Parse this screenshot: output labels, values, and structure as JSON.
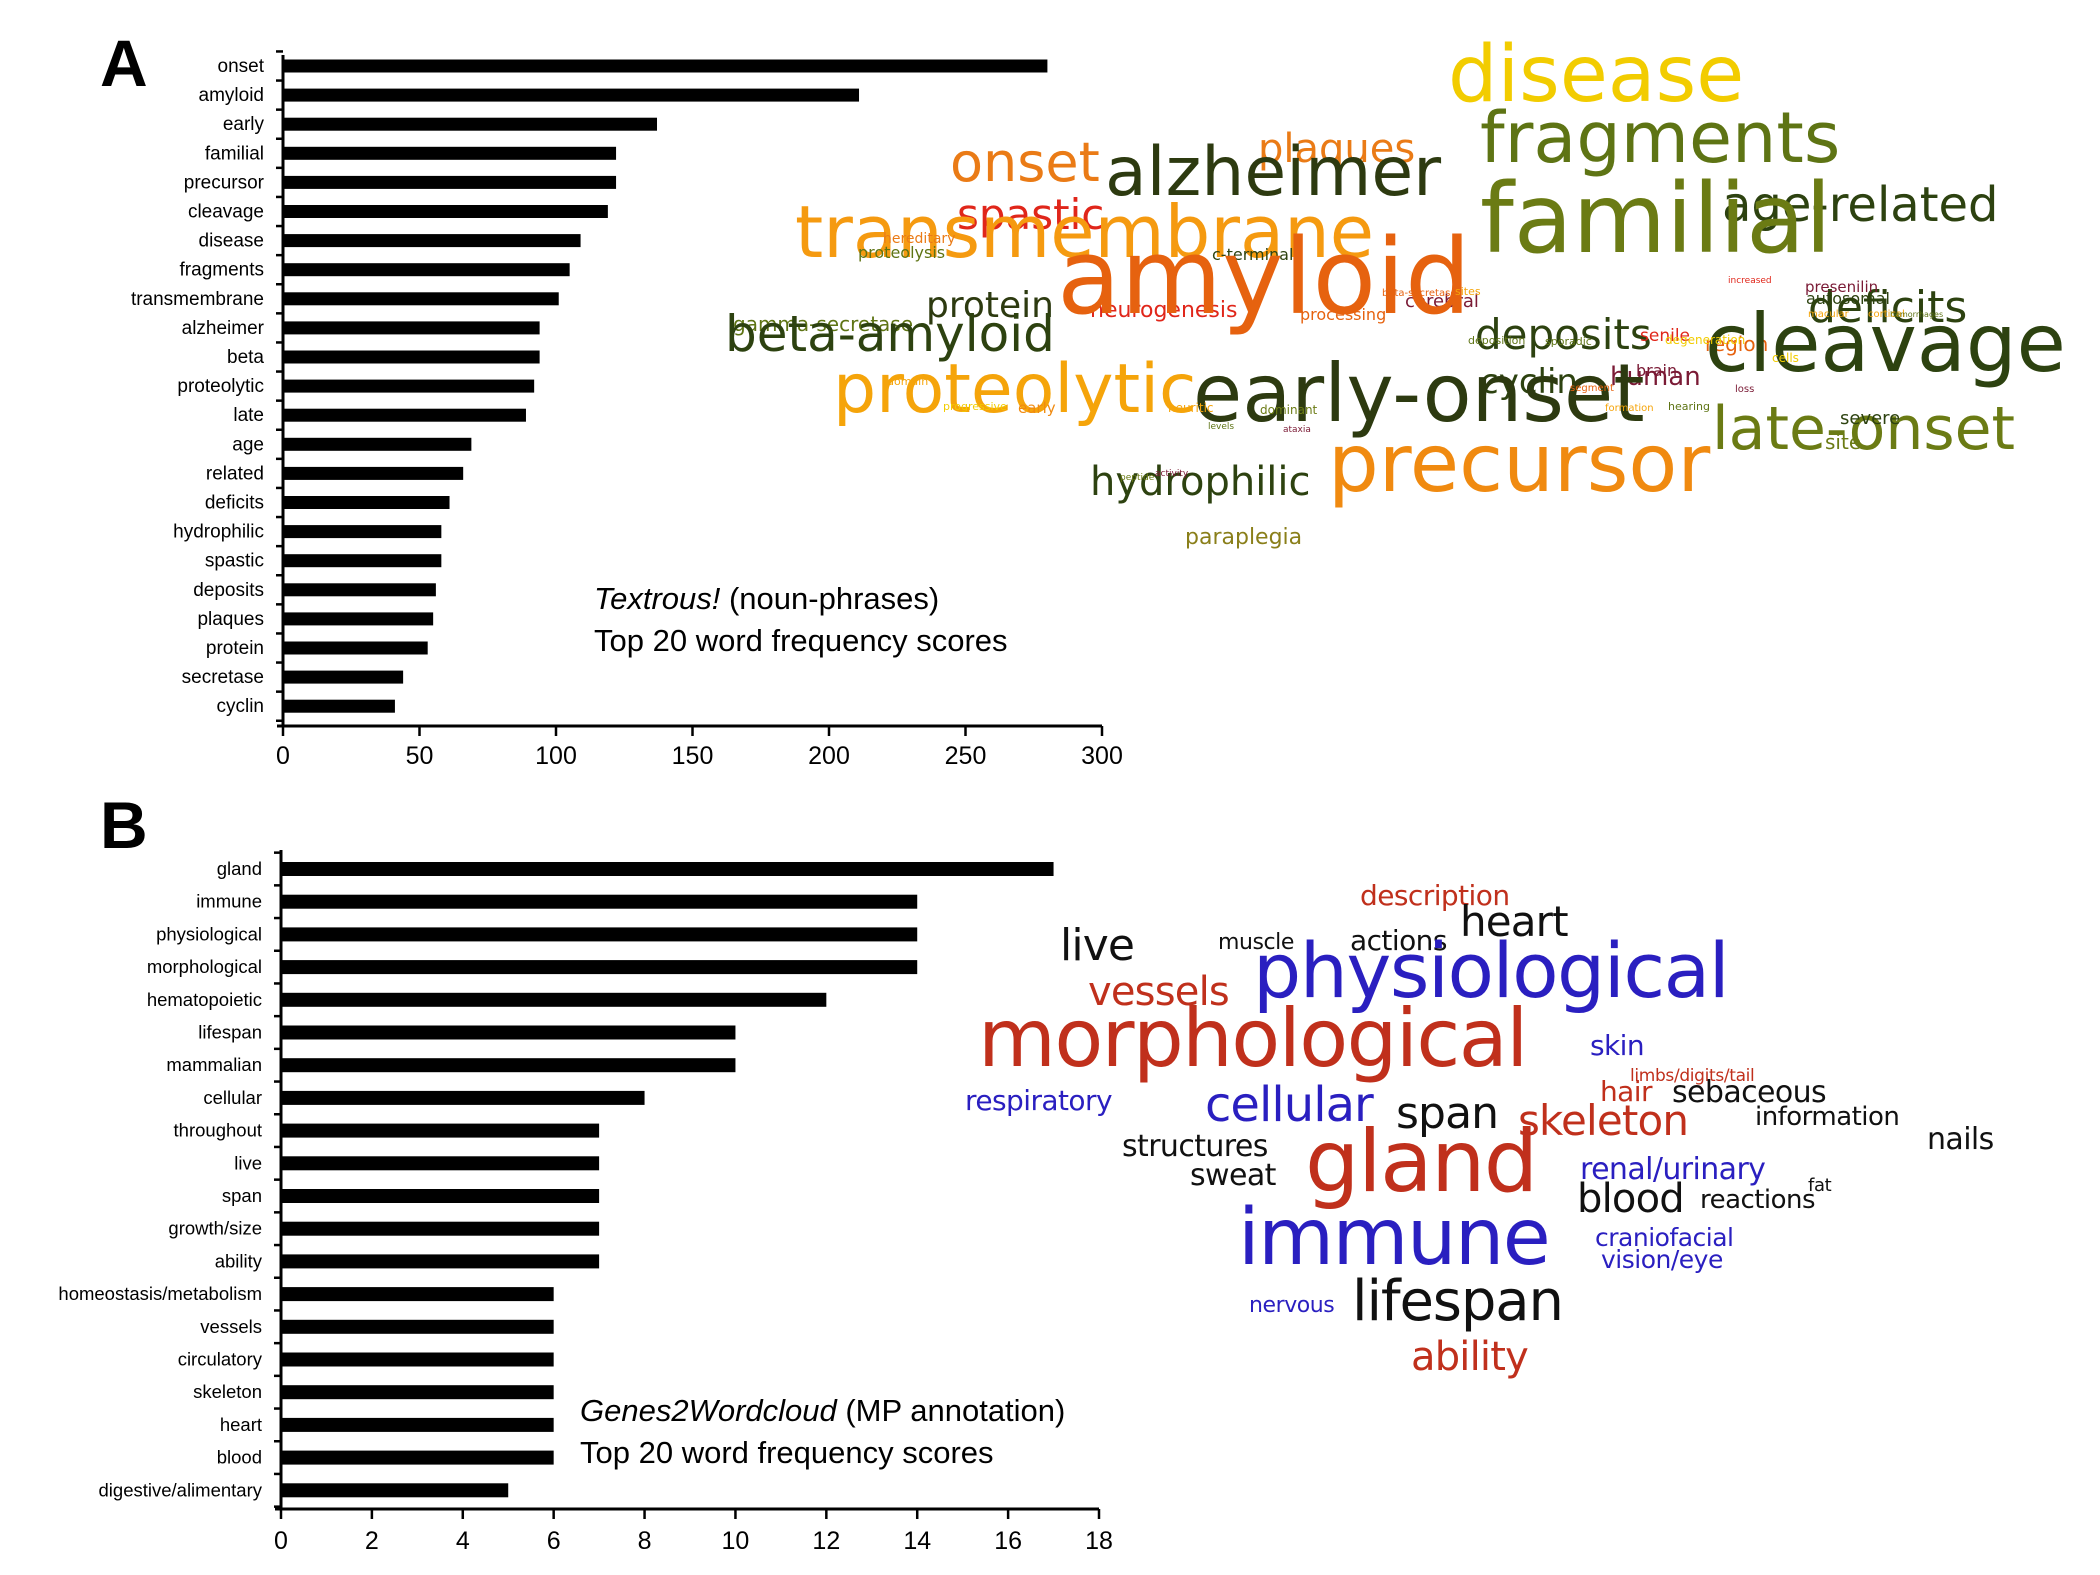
{
  "figure": {
    "panels": [
      {
        "letter": "A",
        "caption_italic": "Textrous!",
        "caption_rest": " (noun-phrases)",
        "caption_line2": "Top 20 word frequency scores"
      },
      {
        "letter": "B",
        "caption_italic": "Genes2Wordcloud",
        "caption_rest": " (MP annotation)",
        "caption_line2": "Top 20 word frequency scores"
      }
    ]
  },
  "chart_data": [
    {
      "type": "bar",
      "orientation": "horizontal",
      "panel": "A",
      "title": "Textrous! (noun-phrases) Top 20 word frequency scores",
      "xlabel": "",
      "ylabel": "",
      "xlim": [
        0,
        300
      ],
      "xticks": [
        0,
        50,
        100,
        150,
        200,
        250,
        300
      ],
      "grid": false,
      "bar_color": "#000000",
      "categories": [
        "onset",
        "amyloid",
        "early",
        "familial",
        "precursor",
        "cleavage",
        "disease",
        "fragments",
        "transmembrane",
        "alzheimer",
        "beta",
        "proteolytic",
        "late",
        "age",
        "related",
        "deficits",
        "hydrophilic",
        "spastic",
        "deposits",
        "plaques",
        "protein",
        "secretase",
        "cyclin"
      ],
      "values": [
        280,
        211,
        137,
        122,
        122,
        119,
        109,
        105,
        101,
        94,
        94,
        92,
        89,
        69,
        66,
        61,
        58,
        58,
        56,
        55,
        53,
        44,
        41
      ]
    },
    {
      "type": "bar",
      "orientation": "horizontal",
      "panel": "B",
      "title": "Genes2Wordcloud (MP annotation) Top 20 word frequency scores",
      "xlabel": "",
      "ylabel": "",
      "xlim": [
        0,
        18
      ],
      "xticks": [
        0,
        2,
        4,
        6,
        8,
        10,
        12,
        14,
        16,
        18
      ],
      "grid": false,
      "bar_color": "#000000",
      "categories": [
        "gland",
        "immune",
        "physiological",
        "morphological",
        "hematopoietic",
        "lifespan",
        "mammalian",
        "cellular",
        "throughout",
        "live",
        "span",
        "growth/size",
        "ability",
        "homeostasis/metabolism",
        "vessels",
        "circulatory",
        "skeleton",
        "heart",
        "blood",
        "digestive/alimentary"
      ],
      "values": [
        17,
        14,
        14,
        14,
        12,
        10,
        10,
        8,
        7,
        7,
        7,
        7,
        7,
        6,
        6,
        6,
        6,
        6,
        6,
        5
      ]
    }
  ],
  "wordclouds": {
    "A": {
      "colors": {
        "yellow": "#f2cc00",
        "olive": "#5e7414",
        "darkgreen": "#2d4210",
        "orange": "#f08a10",
        "darkorange": "#e6620f",
        "red": "#e0261a",
        "maroon": "#7a1a35",
        "amber": "#f5a40a"
      },
      "words": [
        {
          "text": "disease",
          "color": "#f2cc00",
          "size": 5
        },
        {
          "text": "fragments",
          "color": "#5e7414",
          "size": 4
        },
        {
          "text": "plaques",
          "color": "#ea7b16",
          "size": 2
        },
        {
          "text": "onset",
          "color": "#ea7b16",
          "size": 3
        },
        {
          "text": "alzheimer",
          "color": "#2d3a10",
          "size": 4
        },
        {
          "text": "spastic",
          "color": "#e0261a",
          "size": 2
        },
        {
          "text": "age-related",
          "color": "#2d4210",
          "size": 3
        },
        {
          "text": "transmembrane",
          "color": "#f59a10",
          "size": 5
        },
        {
          "text": "familial",
          "color": "#6b7b14",
          "size": 6
        },
        {
          "text": "hereditary",
          "color": "#ea7b16",
          "size": 0
        },
        {
          "text": "proteolysis",
          "color": "#5e7414",
          "size": 0
        },
        {
          "text": "c-terminal",
          "color": "#2d4210",
          "size": 0
        },
        {
          "text": "gamma-secretase",
          "color": "#5e7414",
          "size": 1
        },
        {
          "text": "protein",
          "color": "#2d3a10",
          "size": 2
        },
        {
          "text": "neurogenesis",
          "color": "#e0261a",
          "size": 1
        },
        {
          "text": "processing",
          "color": "#e6620f",
          "size": 1
        },
        {
          "text": "cerebral",
          "color": "#7a1a35",
          "size": 1
        },
        {
          "text": "deficits",
          "color": "#2d4210",
          "size": 3
        },
        {
          "text": "presenilin",
          "color": "#7a1a35",
          "size": 0
        },
        {
          "text": "autosomal",
          "color": "#2d4210",
          "size": 1
        },
        {
          "text": "beta-amyloid",
          "color": "#2d4210",
          "size": 4
        },
        {
          "text": "amyloid",
          "color": "#e6620f",
          "size": 7
        },
        {
          "text": "deposits",
          "color": "#2d4210",
          "size": 3
        },
        {
          "text": "region",
          "color": "#e6620f",
          "size": 1
        },
        {
          "text": "cleavage",
          "color": "#2d4210",
          "size": 6
        },
        {
          "text": "cyclin",
          "color": "#2d4210",
          "size": 2
        },
        {
          "text": "human",
          "color": "#7a1a35",
          "size": 2
        },
        {
          "text": "brain",
          "color": "#7a1a35",
          "size": 1
        },
        {
          "text": "senile",
          "color": "#e0261a",
          "size": 1
        },
        {
          "text": "proteolytic",
          "color": "#f5a40a",
          "size": 5
        },
        {
          "text": "early-onset",
          "color": "#2d3a10",
          "size": 6
        },
        {
          "text": "late-onset",
          "color": "#6b7b14",
          "size": 5
        },
        {
          "text": "severe",
          "color": "#2d4210",
          "size": 1
        },
        {
          "text": "site",
          "color": "#6b7b14",
          "size": 1
        },
        {
          "text": "hydrophilic",
          "color": "#2d4210",
          "size": 3
        },
        {
          "text": "precursor",
          "color": "#f08a10",
          "size": 6
        },
        {
          "text": "paraplegia",
          "color": "#8a7f1a",
          "size": 1
        },
        {
          "text": "progressive",
          "color": "#f2cc00",
          "size": 0
        },
        {
          "text": "early",
          "color": "#f08a10",
          "size": 0
        },
        {
          "text": "neuritic",
          "color": "#f5a40a",
          "size": 0
        },
        {
          "text": "dominant",
          "color": "#6b7b14",
          "size": 0
        },
        {
          "text": "domain",
          "color": "#f5a40a",
          "size": 0
        },
        {
          "text": "deposition",
          "color": "#5e7414",
          "size": 0
        },
        {
          "text": "sporadic",
          "color": "#5e7414",
          "size": 0
        },
        {
          "text": "degeneration",
          "color": "#f2cc00",
          "size": 0
        },
        {
          "text": "hearing",
          "color": "#5e7414",
          "size": 0
        },
        {
          "text": "activity",
          "color": "#7a1a35",
          "size": 0
        },
        {
          "text": "peptide",
          "color": "#6b7b14",
          "size": 0
        },
        {
          "text": "ataxia",
          "color": "#7a1a35",
          "size": 0
        },
        {
          "text": "levels",
          "color": "#5e7414",
          "size": 0
        },
        {
          "text": "beta-secretase",
          "color": "#e6620f",
          "size": 0
        },
        {
          "text": "sites",
          "color": "#f5a40a",
          "size": 0
        },
        {
          "text": "macular",
          "color": "#f5a40a",
          "size": 0
        },
        {
          "text": "cortical",
          "color": "#f5a40a",
          "size": 0
        },
        {
          "text": "hemorrhages",
          "color": "#5e7414",
          "size": 0
        },
        {
          "text": "cells",
          "color": "#f2cc00",
          "size": 0
        },
        {
          "text": "increased",
          "color": "#e0261a",
          "size": 0
        },
        {
          "text": "segment",
          "color": "#e6620f",
          "size": 0
        },
        {
          "text": "formation",
          "color": "#f5a40a",
          "size": 0
        },
        {
          "text": "loss",
          "color": "#7a1a35",
          "size": 0
        }
      ]
    },
    "B": {
      "words": [
        {
          "text": "description",
          "color": "#c0301c",
          "size": 1
        },
        {
          "text": "live",
          "color": "#111111",
          "size": 2
        },
        {
          "text": "muscle",
          "color": "#111111",
          "size": 0
        },
        {
          "text": "actions",
          "color": "#111111",
          "size": 1
        },
        {
          "text": "heart",
          "color": "#111111",
          "size": 2
        },
        {
          "text": "vessels",
          "color": "#c0301c",
          "size": 2
        },
        {
          "text": "physiological",
          "color": "#2a1fc0",
          "size": 5
        },
        {
          "text": "morphological",
          "color": "#c0301c",
          "size": 5
        },
        {
          "text": "skin",
          "color": "#2a1fc0",
          "size": 1
        },
        {
          "text": "limbs/digits/tail",
          "color": "#c0301c",
          "size": 0
        },
        {
          "text": "respiratory",
          "color": "#2a1fc0",
          "size": 1
        },
        {
          "text": "cellular",
          "color": "#2a1fc0",
          "size": 3
        },
        {
          "text": "span",
          "color": "#111111",
          "size": 3
        },
        {
          "text": "hair",
          "color": "#c0301c",
          "size": 1
        },
        {
          "text": "sebaceous",
          "color": "#111111",
          "size": 1
        },
        {
          "text": "skeleton",
          "color": "#c0301c",
          "size": 2
        },
        {
          "text": "information",
          "color": "#111111",
          "size": 1
        },
        {
          "text": "nails",
          "color": "#111111",
          "size": 1
        },
        {
          "text": "structures",
          "color": "#111111",
          "size": 1
        },
        {
          "text": "sweat",
          "color": "#111111",
          "size": 1
        },
        {
          "text": "gland",
          "color": "#c0301c",
          "size": 6
        },
        {
          "text": "renal/urinary",
          "color": "#2a1fc0",
          "size": 1
        },
        {
          "text": "fat",
          "color": "#111111",
          "size": 0
        },
        {
          "text": "blood",
          "color": "#111111",
          "size": 2
        },
        {
          "text": "reactions",
          "color": "#111111",
          "size": 1
        },
        {
          "text": "immune",
          "color": "#2a1fc0",
          "size": 6
        },
        {
          "text": "craniofacial",
          "color": "#2a1fc0",
          "size": 1
        },
        {
          "text": "vision/eye",
          "color": "#2a1fc0",
          "size": 1
        },
        {
          "text": "nervous",
          "color": "#2a1fc0",
          "size": 0
        },
        {
          "text": "lifespan",
          "color": "#111111",
          "size": 4
        },
        {
          "text": "ability",
          "color": "#c0301c",
          "size": 2
        }
      ]
    }
  }
}
